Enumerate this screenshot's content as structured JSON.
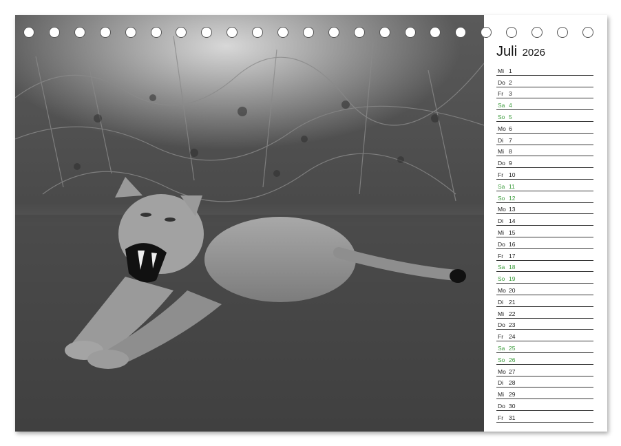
{
  "calendar": {
    "month": "Juli",
    "year": "2026",
    "days": [
      {
        "wd": "Mi",
        "n": "1",
        "we": false
      },
      {
        "wd": "Do",
        "n": "2",
        "we": false
      },
      {
        "wd": "Fr",
        "n": "3",
        "we": false
      },
      {
        "wd": "Sa",
        "n": "4",
        "we": true
      },
      {
        "wd": "So",
        "n": "5",
        "we": true
      },
      {
        "wd": "Mo",
        "n": "6",
        "we": false
      },
      {
        "wd": "Di",
        "n": "7",
        "we": false
      },
      {
        "wd": "Mi",
        "n": "8",
        "we": false
      },
      {
        "wd": "Do",
        "n": "9",
        "we": false
      },
      {
        "wd": "Fr",
        "n": "10",
        "we": false
      },
      {
        "wd": "Sa",
        "n": "11",
        "we": true
      },
      {
        "wd": "So",
        "n": "12",
        "we": true
      },
      {
        "wd": "Mo",
        "n": "13",
        "we": false
      },
      {
        "wd": "Di",
        "n": "14",
        "we": false
      },
      {
        "wd": "Mi",
        "n": "15",
        "we": false
      },
      {
        "wd": "Do",
        "n": "16",
        "we": false
      },
      {
        "wd": "Fr",
        "n": "17",
        "we": false
      },
      {
        "wd": "Sa",
        "n": "18",
        "we": true
      },
      {
        "wd": "So",
        "n": "19",
        "we": true
      },
      {
        "wd": "Mo",
        "n": "20",
        "we": false
      },
      {
        "wd": "Di",
        "n": "21",
        "we": false
      },
      {
        "wd": "Mi",
        "n": "22",
        "we": false
      },
      {
        "wd": "Do",
        "n": "23",
        "we": false
      },
      {
        "wd": "Fr",
        "n": "24",
        "we": false
      },
      {
        "wd": "Sa",
        "n": "25",
        "we": true
      },
      {
        "wd": "So",
        "n": "26",
        "we": true
      },
      {
        "wd": "Mo",
        "n": "27",
        "we": false
      },
      {
        "wd": "Di",
        "n": "28",
        "we": false
      },
      {
        "wd": "Mi",
        "n": "29",
        "we": false
      },
      {
        "wd": "Do",
        "n": "30",
        "we": false
      },
      {
        "wd": "Fr",
        "n": "31",
        "we": false
      }
    ]
  },
  "colors": {
    "weekend": "#3a9a3a",
    "weekday": "#222222"
  },
  "photo": {
    "subject": "lioness-photo"
  }
}
